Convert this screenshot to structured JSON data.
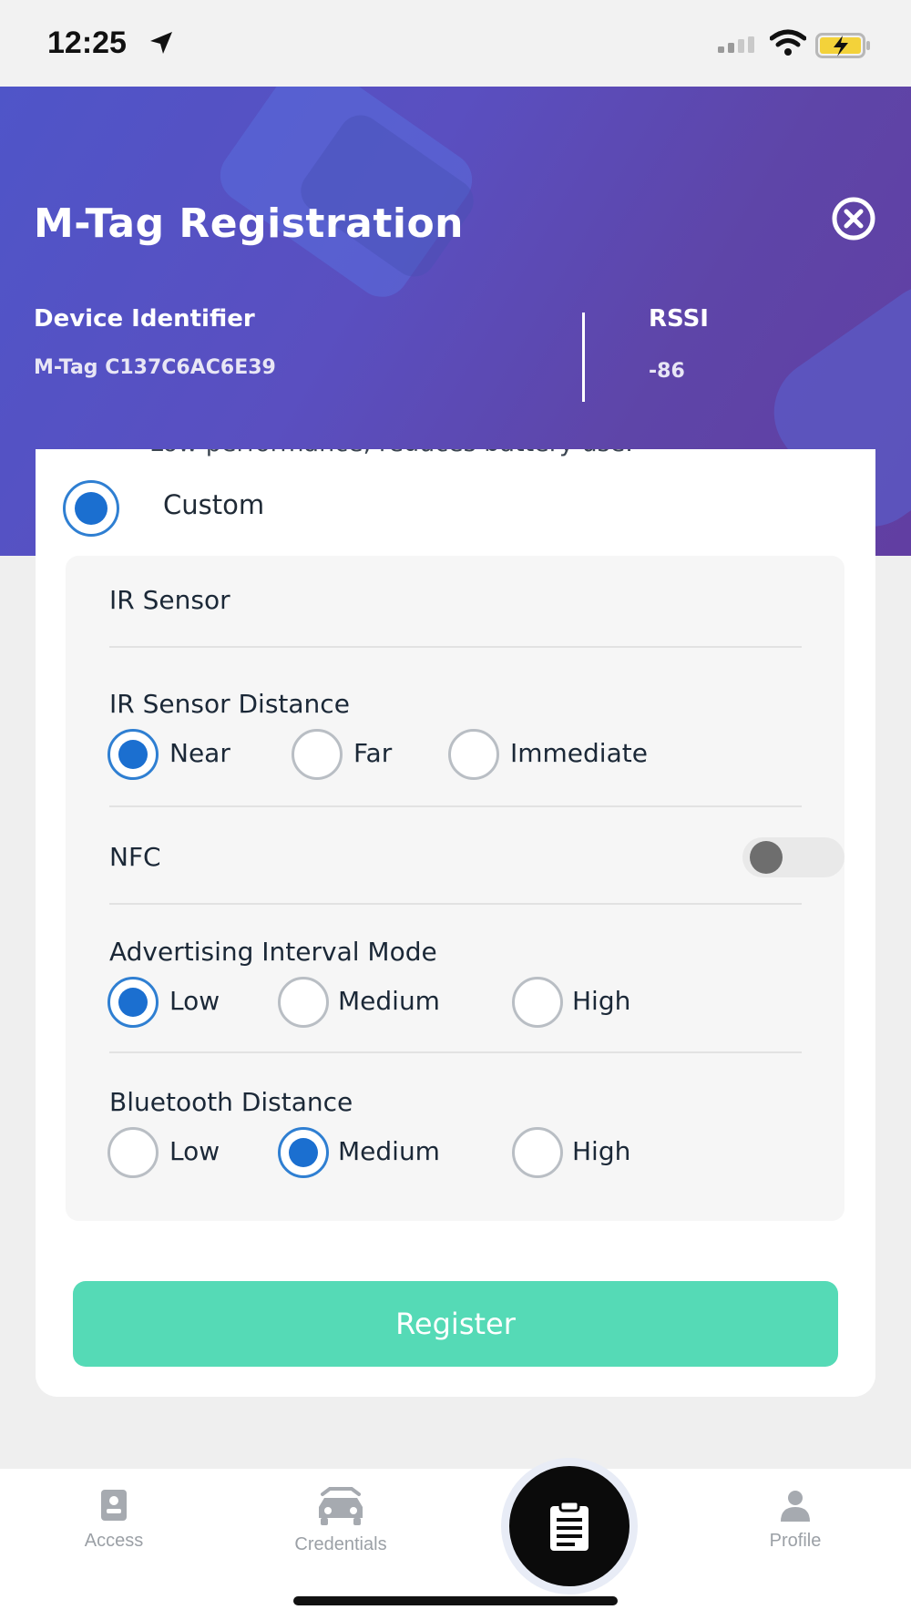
{
  "status_bar": {
    "time": "12:25"
  },
  "header": {
    "title": "M-Tag Registration",
    "device_identifier_label": "Device Identifier",
    "device_identifier_value": "M-Tag C137C6AC6E39",
    "rssi_label": "RSSI",
    "rssi_value": "-86"
  },
  "card": {
    "cut_text": "Low performance, reduces battery use.",
    "custom_option": {
      "label": "Custom",
      "selected": true
    },
    "ir_sensor": {
      "title": "IR Sensor"
    },
    "ir_sensor_distance": {
      "title": "IR Sensor Distance",
      "options": [
        "Near",
        "Far",
        "Immediate"
      ],
      "selected": "Near"
    },
    "nfc": {
      "title": "NFC",
      "enabled": false
    },
    "advertising_interval_mode": {
      "title": "Advertising Interval Mode",
      "options": [
        "Low",
        "Medium",
        "High"
      ],
      "selected": "Low"
    },
    "bluetooth_distance": {
      "title": "Bluetooth Distance",
      "options": [
        "Low",
        "Medium",
        "High"
      ],
      "selected": "Medium"
    },
    "register_label": "Register"
  },
  "bottom_nav": {
    "items": [
      {
        "label": "Access",
        "icon": "badge-icon"
      },
      {
        "label": "Credentials",
        "icon": "car-icon"
      },
      {
        "label": "",
        "icon": "clipboard-icon"
      },
      {
        "label": "Profile",
        "icon": "person-icon"
      }
    ]
  },
  "colors": {
    "header_gradient_start": "#4f55c8",
    "header_gradient_end": "#613ea2",
    "radio_selected": "#1b6fd0",
    "register_button": "#55dab6",
    "nav_label": "#9ba0a6"
  }
}
